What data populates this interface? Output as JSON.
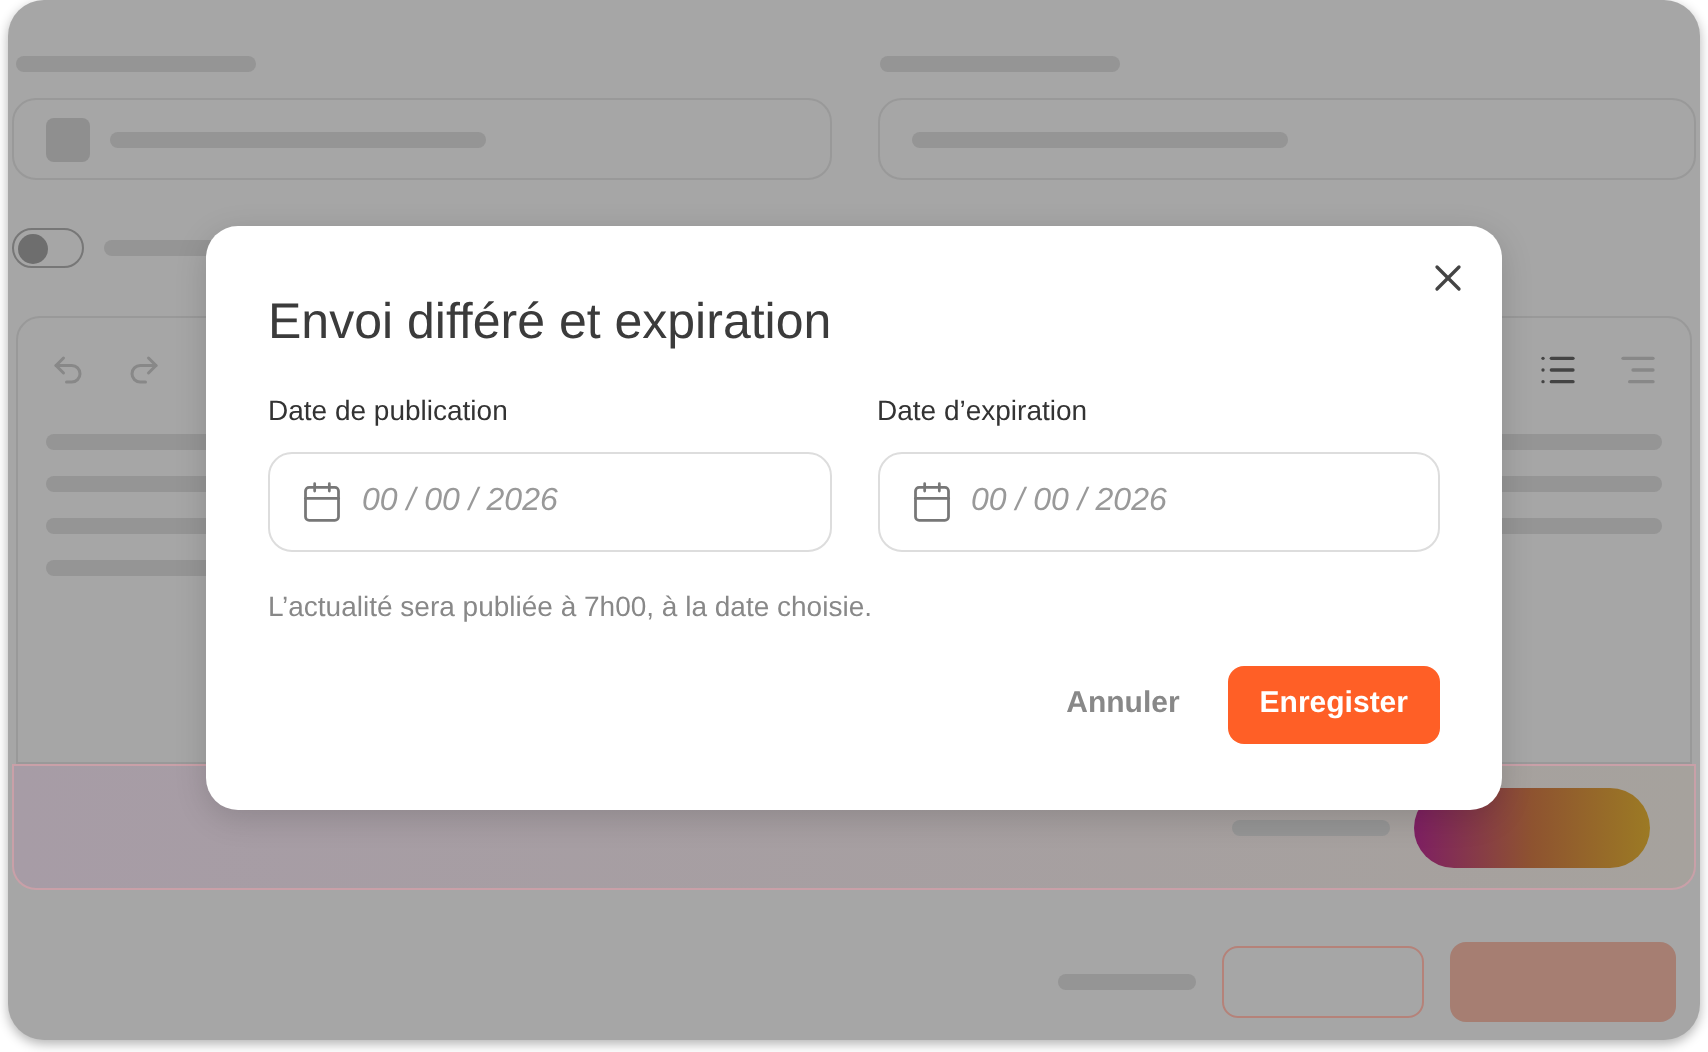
{
  "background": {
    "toggle": {
      "on": false
    }
  },
  "dialog": {
    "title": "Envoi différé et expiration",
    "fields": [
      {
        "label": "Date de publication",
        "placeholder": "00 / 00 / 2026"
      },
      {
        "label": "Date d’expiration",
        "placeholder": "00 / 00 / 2026"
      }
    ],
    "hint": "L’actualité sera publiée à 7h00, à la date choisie.",
    "buttons": [
      {
        "kind": "secondary",
        "label": "Annuler"
      },
      {
        "kind": "primary",
        "label": "Enregister"
      }
    ]
  }
}
